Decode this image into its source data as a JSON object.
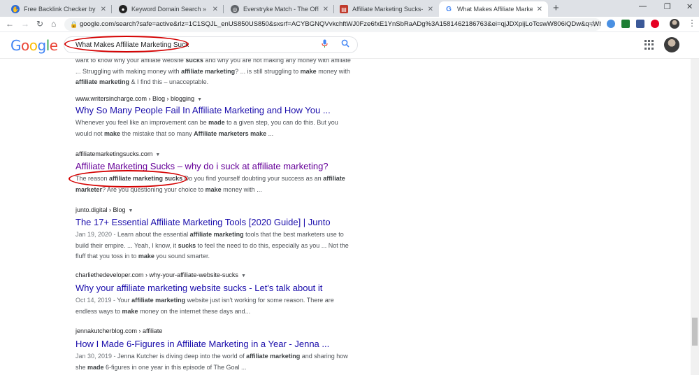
{
  "browser": {
    "tabs": [
      {
        "title": "Free Backlink Checker by Ahrefs",
        "favicon_color": "#2b6cd8",
        "favicon_glyph": "✋",
        "active": false
      },
      {
        "title": "Keyword Domain Search » Expired",
        "favicon_color": "#222222",
        "favicon_glyph": "●",
        "active": false
      },
      {
        "title": "Everstryke Match - The Official Pa",
        "favicon_color": "#5f6368",
        "favicon_glyph": "◎",
        "active": false
      },
      {
        "title": "Affiliate Marketing Sucks- Why D",
        "favicon_color": "#c0392b",
        "favicon_glyph": "▤",
        "active": false
      },
      {
        "title": "What Makes Affiliate Marketing S",
        "favicon_color": "#ffffff",
        "favicon_glyph": "G",
        "active": true
      }
    ],
    "url": "google.com/search?safe=active&rlz=1C1SQJL_enUS850US850&sxsrf=ACYBGNQVvkchftWJ0Fze6fxE1YnSbRaADg%3A1581462186763&ei=qjJDXpijLoTcswW806iQDw&q=What+..."
  },
  "google": {
    "search_query": "What Makes Affiliate Marketing Suck"
  },
  "results": [
    {
      "id": "r0",
      "cite": "",
      "title": "",
      "snippet_html": "want to know why your affiliate website <b>sucks</b> and why you are not making any money with affiliate ... Struggling with making money with <b>affiliate marketing</b>? ... is still struggling to <b>make</b> money with <b>affiliate marketing</b> &amp; I find this – unacceptable.",
      "visited": false
    },
    {
      "id": "r1",
      "cite": "www.writersincharge.com › Blog › blogging",
      "title": "Why So Many People Fail In Affiliate Marketing and How You ...",
      "snippet_html": "Whenever you feel like an improvement can be <b>made</b> to a given step, you can do this. But you would not <b>make</b> the mistake that so many <b>Affiliate marketers make</b> ...",
      "visited": false
    },
    {
      "id": "r2",
      "cite": "affiliatemarketingsucks.com",
      "title": "Affiliate Marketing Sucks – why do i suck at affiliate marketing?",
      "snippet_html": "The reason <b>affiliate marketing sucks</b> Do you find yourself doubting your success as an <b>affiliate marketer</b>? Are you questioning your choice to <b>make</b> money with ...",
      "visited": true
    },
    {
      "id": "r3",
      "cite": "junto.digital › Blog",
      "title": "The 17+ Essential Affiliate Marketing Tools [2020 Guide] | Junto",
      "snippet_html": "<span class='date'>Jan 19, 2020 - </span>Learn about the essential <b>affiliate marketing</b> tools that the best marketers use to build their empire. ... Yeah, I know, it <b>sucks</b> to feel the need to do this, especially as you ... Not the fluff that you toss in to <b>make</b> you sound smarter.",
      "visited": false
    },
    {
      "id": "r4",
      "cite": "charliethedeveloper.com › why-your-affiliate-website-sucks",
      "title": "Why your affiliate marketing website sucks - Let's talk about it",
      "snippet_html": "<span class='date'>Oct 14, 2019 - </span>Your <b>affiliate marketing</b> website just isn't working for some reason. There are endless ways to <b>make</b> money on the internet these days and...",
      "visited": false
    },
    {
      "id": "r5",
      "cite": "jennakutcherblog.com › affiliate",
      "title": "How I Made 6-Figures in Affiliate Marketing in a Year - Jenna ...",
      "snippet_html": "<span class='date'>Jan 30, 2019 - </span>Jenna Kutcher is diving deep into the world of <b>affiliate marketing</b> and sharing how she <b>made</b> 6-figures in one year in this episode of The Goal ...",
      "visited": false
    }
  ],
  "colors": {
    "link": "#1a0dab",
    "visited": "#660099",
    "annotation": "#d40000"
  }
}
